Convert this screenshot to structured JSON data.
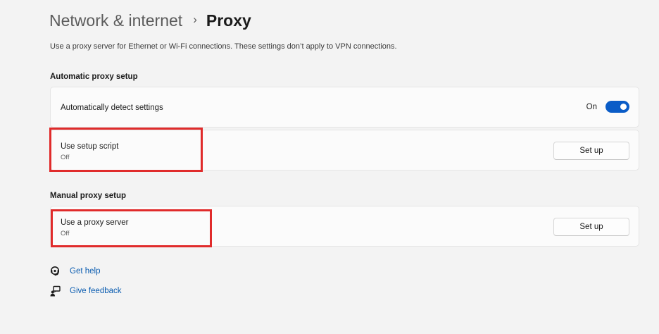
{
  "breadcrumb": {
    "parent": "Network & internet",
    "separator": "›",
    "current": "Proxy"
  },
  "description": "Use a proxy server for Ethernet or Wi-Fi connections. These settings don’t apply to VPN connections.",
  "automatic": {
    "section_title": "Automatic proxy setup",
    "detect": {
      "title": "Automatically detect settings",
      "toggle_state": "On",
      "toggle_on": true
    },
    "script": {
      "title": "Use setup script",
      "status": "Off",
      "button_label": "Set up"
    }
  },
  "manual": {
    "section_title": "Manual proxy setup",
    "proxy": {
      "title": "Use a proxy server",
      "status": "Off",
      "button_label": "Set up"
    }
  },
  "links": {
    "help": "Get help",
    "feedback": "Give feedback"
  },
  "colors": {
    "accent": "#0a5cc7",
    "highlight": "#e02b2b",
    "link": "#0a5cb0",
    "background": "#f3f3f3"
  },
  "icons": {
    "help": "help-headset-icon",
    "feedback": "feedback-icon"
  }
}
